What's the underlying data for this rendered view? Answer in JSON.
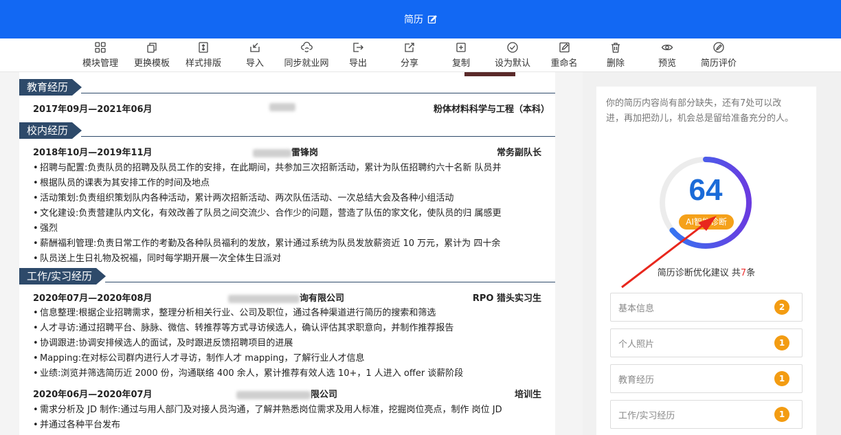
{
  "header": {
    "title": "简历"
  },
  "toolbar": {
    "items": [
      {
        "label": "模块管理",
        "icon": "grid-icon"
      },
      {
        "label": "更换模板",
        "icon": "copy-icon"
      },
      {
        "label": "样式排版",
        "icon": "layout-icon"
      },
      {
        "label": "导入",
        "icon": "import-icon"
      },
      {
        "label": "同步就业网",
        "icon": "cloud-sync-icon"
      },
      {
        "label": "导出",
        "icon": "export-icon"
      },
      {
        "label": "分享",
        "icon": "share-icon"
      },
      {
        "label": "复制",
        "icon": "duplicate-icon"
      },
      {
        "label": "设为默认",
        "icon": "check-circle-icon"
      },
      {
        "label": "重命名",
        "icon": "rename-icon"
      },
      {
        "label": "删除",
        "icon": "trash-icon"
      },
      {
        "label": "预览",
        "icon": "eye-icon"
      },
      {
        "label": "简历评价",
        "icon": "review-icon"
      }
    ]
  },
  "resume": {
    "education": {
      "title": "教育经历",
      "date": "2017年09月—2021年06月",
      "major": "粉体材料科学与工程（本科）"
    },
    "campus": {
      "title": "校内经历",
      "date": "2018年10月—2019年11月",
      "org": "雷锋岗",
      "role": "常务副队长",
      "bullets": [
        "招聘与配置:负责队员的招聘及队员工作的安排，在此期间，共参加三次招新活动，累计为队伍招聘约六十名新 队员并",
        "根据队员的课表为其安排工作的时间及地点",
        "活动策划:负责组织策划队内各种活动，累计两次招新活动、两次队伍活动、一次总结大会及各种小组活动",
        "文化建设:负责营建队内文化，有效改善了队员之间交流少、合作少的问题，营造了队伍的家文化，使队员的归 属感更",
        "强烈",
        "薪酬福利管理:负责日常工作的考勤及各种队员福利的发放，累计通过系统为队员发放薪资近 10 万元，累计为 四十余",
        "队员送上生日礼物及祝福，同时每学期开展一次全体生日派对"
      ]
    },
    "work": {
      "title": "工作/实习经历",
      "job1": {
        "date": "2020年07月—2020年08月",
        "company": "询有限公司",
        "role": "RPO 猎头实习生",
        "bullets": [
          "信息整理:根据企业招聘需求，整理分析相关行业、公司及职位，通过各种渠道进行简历的搜索和筛选",
          "人才寻访:通过招聘平台、脉脉、微信、转推荐等方式寻访候选人，确认评估其求职意向，并制作推荐报告",
          "协调跟进:协调安排候选人的面试，及时跟进反馈招聘项目的进展",
          "Mapping:在对标公司群内进行人才寻访，制作人才 mapping，了解行业人才信息",
          "业绩:浏览并筛选简历近 2000 份，沟通联络 400 余人，累计推荐有效人选 10+，1 人进入 offer 谈薪阶段"
        ]
      },
      "job2": {
        "date": "2020年06月—2020年07月",
        "company": "限公司",
        "role": "培训生",
        "bullets": [
          "需求分析及 JD 制作:通过与用人部门及对接人员沟通，了解并熟悉岗位需求及用人标准，挖掘岗位亮点，制作 岗位 JD",
          "并通过各种平台发布"
        ]
      }
    }
  },
  "panel": {
    "intro": "你的简历内容尚有部分缺失，还有7处可以改进，再加把劲儿，机会总是留给准备充分的人。",
    "score": "64",
    "score_fraction": 0.64,
    "diagnose_button": "AI智能诊断",
    "suggest_prefix": "简历诊断优化建议 共",
    "suggest_count": "7",
    "suggest_suffix": "条",
    "items": [
      {
        "label": "基本信息",
        "count": "2"
      },
      {
        "label": "个人照片",
        "count": "1"
      },
      {
        "label": "教育经历",
        "count": "1"
      },
      {
        "label": "工作/实习经历",
        "count": "1"
      }
    ]
  },
  "colors": {
    "header_blue": "#1268f3",
    "section_navy": "#2e4a6a",
    "score_blue": "#1b6bd8",
    "badge_orange": "#f39c12",
    "arrow_red": "#e8271d"
  }
}
